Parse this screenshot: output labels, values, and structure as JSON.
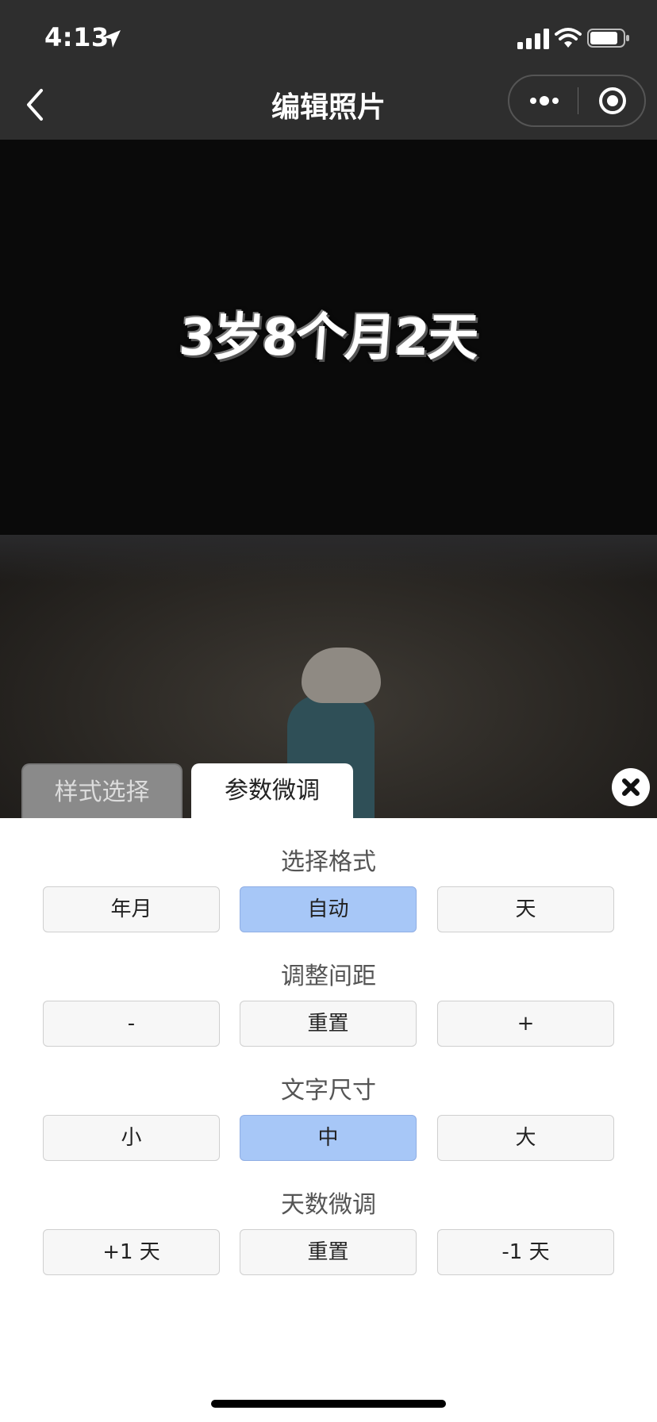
{
  "status_bar": {
    "time": "4:13",
    "icons": [
      "location-arrow-icon",
      "signal-icon",
      "wifi-icon",
      "battery-icon"
    ]
  },
  "nav": {
    "title": "编辑照片",
    "back_icon": "chevron-left-icon",
    "more_icon": "more-dots-icon",
    "close_icon": "target-circle-icon"
  },
  "photo": {
    "overlay_text": "3岁8个月2天"
  },
  "tabs": [
    {
      "label": "样式选择",
      "active": false
    },
    {
      "label": "参数微调",
      "active": true
    }
  ],
  "sections": [
    {
      "title": "选择格式",
      "buttons": [
        {
          "label": "年月",
          "active": false
        },
        {
          "label": "自动",
          "active": true
        },
        {
          "label": "天",
          "active": false
        }
      ]
    },
    {
      "title": "调整间距",
      "buttons": [
        {
          "label": "-",
          "active": false
        },
        {
          "label": "重置",
          "active": false
        },
        {
          "label": "+",
          "active": false
        }
      ]
    },
    {
      "title": "文字尺寸",
      "buttons": [
        {
          "label": "小",
          "active": false
        },
        {
          "label": "中",
          "active": true
        },
        {
          "label": "大",
          "active": false
        }
      ]
    },
    {
      "title": "天数微调",
      "buttons": [
        {
          "label": "+1 天",
          "active": false
        },
        {
          "label": "重置",
          "active": false
        },
        {
          "label": "-1 天",
          "active": false
        }
      ]
    }
  ],
  "colors": {
    "header_bg": "#2e2e2e",
    "active_button": "#a7c7f7",
    "inactive_tab": "#8a8a8a"
  }
}
